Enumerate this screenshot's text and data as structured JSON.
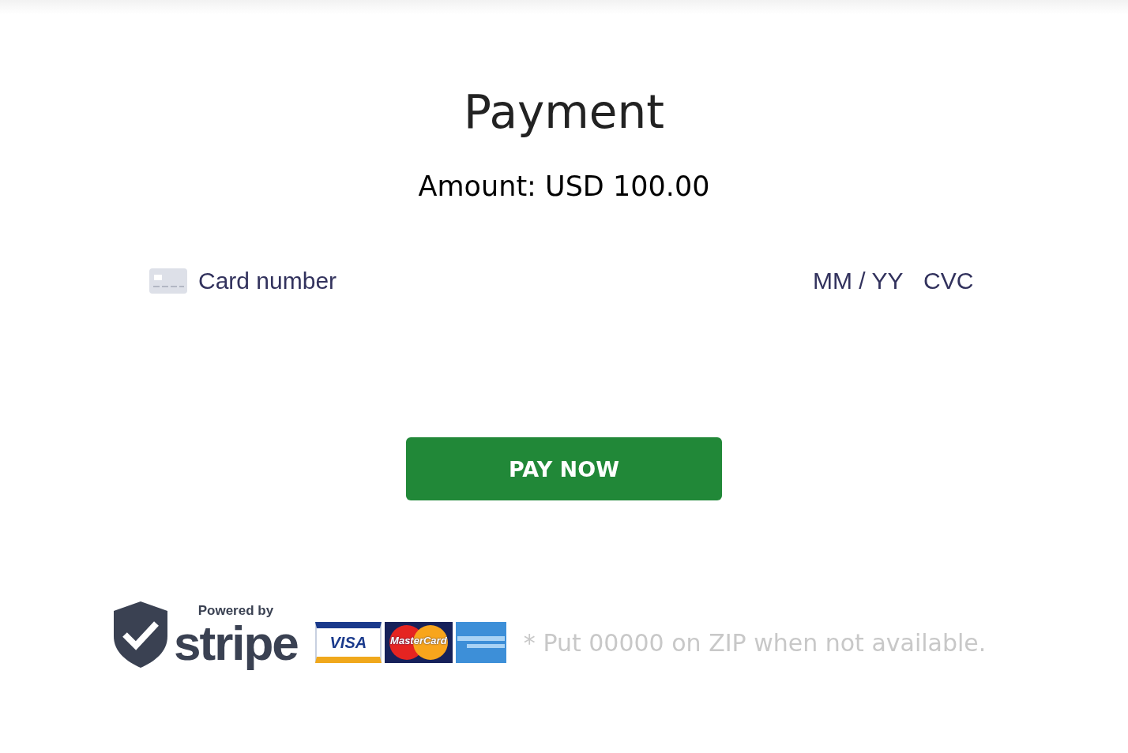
{
  "title": "Payment",
  "amount": "Amount: USD 100.00",
  "card_form": {
    "card_number": {
      "placeholder": "Card number"
    },
    "expiry": {
      "placeholder": "MM / YY"
    },
    "cvc": {
      "placeholder": "CVC"
    }
  },
  "pay_button": "PAY NOW",
  "badge": {
    "powered_by": "Powered by",
    "brand": "stripe",
    "cards": [
      {
        "kind": "visa",
        "label": "VISA"
      },
      {
        "kind": "mastercard",
        "label": "MasterCard"
      },
      {
        "kind": "amex"
      }
    ]
  },
  "note": "* Put 00000 on ZIP when not available."
}
